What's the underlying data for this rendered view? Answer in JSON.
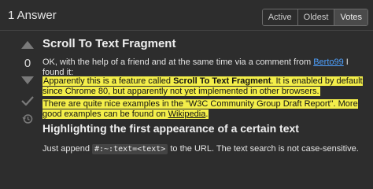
{
  "header": {
    "answers_count": "1 Answer",
    "sort_tabs": [
      {
        "label": "Active"
      },
      {
        "label": "Oldest"
      },
      {
        "label": "Votes"
      }
    ],
    "active_tab": "Votes"
  },
  "vote": {
    "count": "0",
    "icons": [
      "vote-up-icon",
      "vote-down-icon",
      "accepted-check-icon",
      "history-icon"
    ]
  },
  "answer": {
    "title": "Scroll To Text Fragment",
    "p1_before": "OK, with the help of a friend and at the same time via a comment from ",
    "p1_link": "Berto99",
    "p1_after": " I found it:",
    "p2_part1": "Apparently this is a feature called ",
    "p2_bold": "Scroll To Text Fragment",
    "p2_part2": ". It is enabled by default since Chrome 80, but apparently not yet implemented in other browsers.",
    "p3_part1": "There are quite nice examples in the \"W3C Community Group Draft Report\". More good examples can be found on ",
    "p3_link": "Wikipedia",
    "p3_part2": ".",
    "heading2": "Highlighting the first appearance of a certain text",
    "p4_before": "Just append ",
    "p4_code": "#:~:text=<text>",
    "p4_after": " to the URL. The text search is not case-sensitive."
  },
  "colors": {
    "background": "#2d2d2d",
    "highlight": "#f3ee4a",
    "link": "#4ea1ff"
  }
}
